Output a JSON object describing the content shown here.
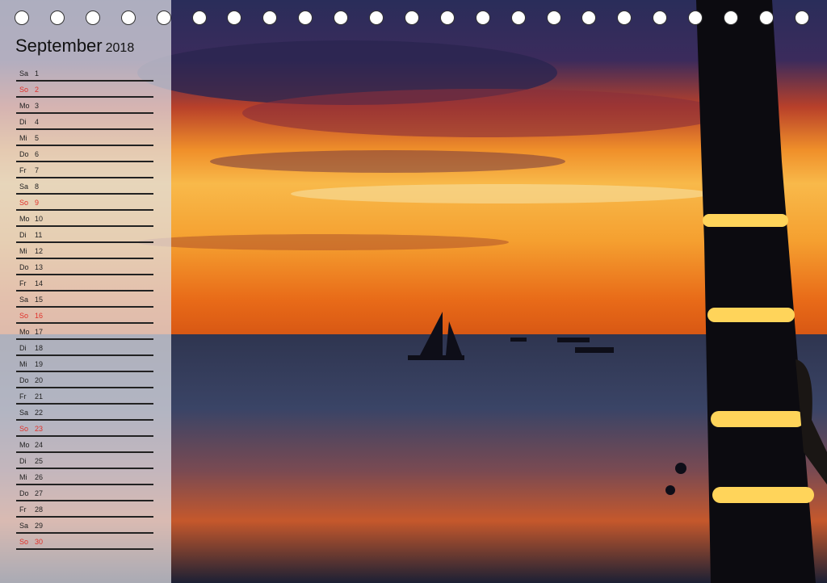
{
  "calendar": {
    "month": "September",
    "year": "2018",
    "days": [
      {
        "wd": "Sa",
        "d": "1",
        "sun": false
      },
      {
        "wd": "So",
        "d": "2",
        "sun": true
      },
      {
        "wd": "Mo",
        "d": "3",
        "sun": false
      },
      {
        "wd": "Di",
        "d": "4",
        "sun": false
      },
      {
        "wd": "Mi",
        "d": "5",
        "sun": false
      },
      {
        "wd": "Do",
        "d": "6",
        "sun": false
      },
      {
        "wd": "Fr",
        "d": "7",
        "sun": false
      },
      {
        "wd": "Sa",
        "d": "8",
        "sun": false
      },
      {
        "wd": "So",
        "d": "9",
        "sun": true
      },
      {
        "wd": "Mo",
        "d": "10",
        "sun": false
      },
      {
        "wd": "Di",
        "d": "11",
        "sun": false
      },
      {
        "wd": "Mi",
        "d": "12",
        "sun": false
      },
      {
        "wd": "Do",
        "d": "13",
        "sun": false
      },
      {
        "wd": "Fr",
        "d": "14",
        "sun": false
      },
      {
        "wd": "Sa",
        "d": "15",
        "sun": false
      },
      {
        "wd": "So",
        "d": "16",
        "sun": true
      },
      {
        "wd": "Mo",
        "d": "17",
        "sun": false
      },
      {
        "wd": "Di",
        "d": "18",
        "sun": false
      },
      {
        "wd": "Mi",
        "d": "19",
        "sun": false
      },
      {
        "wd": "Do",
        "d": "20",
        "sun": false
      },
      {
        "wd": "Fr",
        "d": "21",
        "sun": false
      },
      {
        "wd": "Sa",
        "d": "22",
        "sun": false
      },
      {
        "wd": "So",
        "d": "23",
        "sun": true
      },
      {
        "wd": "Mo",
        "d": "24",
        "sun": false
      },
      {
        "wd": "Di",
        "d": "25",
        "sun": false
      },
      {
        "wd": "Mi",
        "d": "26",
        "sun": false
      },
      {
        "wd": "Do",
        "d": "27",
        "sun": false
      },
      {
        "wd": "Fr",
        "d": "28",
        "sun": false
      },
      {
        "wd": "Sa",
        "d": "29",
        "sun": false
      },
      {
        "wd": "So",
        "d": "30",
        "sun": true
      }
    ]
  },
  "colors": {
    "sunday": "#e0322b",
    "text": "#222222"
  }
}
